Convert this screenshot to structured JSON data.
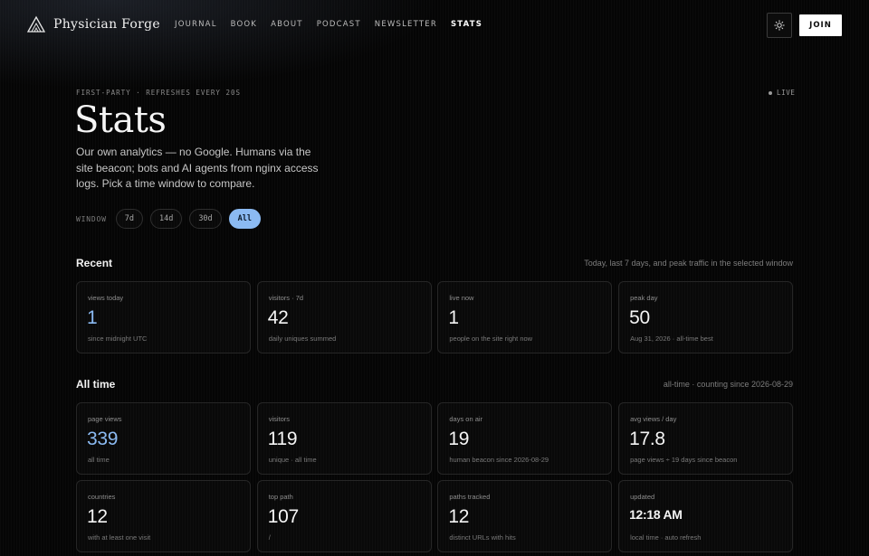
{
  "nav": {
    "brand": "Physician Forge",
    "links": [
      "JOURNAL",
      "BOOK",
      "ABOUT",
      "PODCAST",
      "NEWSLETTER",
      "STATS"
    ],
    "active": "STATS",
    "join_label": "JOIN",
    "theme_icon": "sun-icon"
  },
  "hero": {
    "eyebrow": "FIRST-PARTY · REFRESHES EVERY 20S",
    "live_label": "LIVE",
    "title": "Stats",
    "intro": "Our own analytics — no Google. Humans via the site beacon; bots and AI agents from nginx access logs. Pick a time window to compare."
  },
  "window": {
    "label": "WINDOW",
    "options": [
      "7d",
      "14d",
      "30d",
      "All"
    ],
    "selected": "All"
  },
  "recent": {
    "title": "Recent",
    "note": "Today, last 7 days, and peak traffic in the selected window",
    "cards": [
      {
        "label": "views today",
        "value": "1",
        "sub": "since midnight UTC"
      },
      {
        "label": "visitors · 7d",
        "value": "42",
        "sub": "daily uniques summed"
      },
      {
        "label": "live now",
        "value": "1",
        "sub": "people on the site right now"
      },
      {
        "label": "peak day",
        "value": "50",
        "sub": "Aug 31, 2026 · all-time best"
      }
    ]
  },
  "alltime": {
    "title": "All time",
    "note": "all-time · counting since 2026-08-29",
    "cards": [
      {
        "label": "page views",
        "value": "339",
        "sub": "all time"
      },
      {
        "label": "visitors",
        "value": "119",
        "sub": "unique · all time"
      },
      {
        "label": "days on air",
        "value": "19",
        "sub": "human beacon since 2026-08-29"
      },
      {
        "label": "avg views / day",
        "value": "17.8",
        "sub": "page views ÷ 19 days since beacon"
      },
      {
        "label": "countries",
        "value": "12",
        "sub": "with at least one visit"
      },
      {
        "label": "top path",
        "value": "107",
        "sub": "/"
      },
      {
        "label": "paths tracked",
        "value": "12",
        "sub": "distinct URLs with hits"
      },
      {
        "label": "updated",
        "value": "12:18 AM",
        "sub": "local time · auto refresh"
      }
    ]
  },
  "colors": {
    "accent": "#8bbaf2",
    "background": "#050505"
  }
}
